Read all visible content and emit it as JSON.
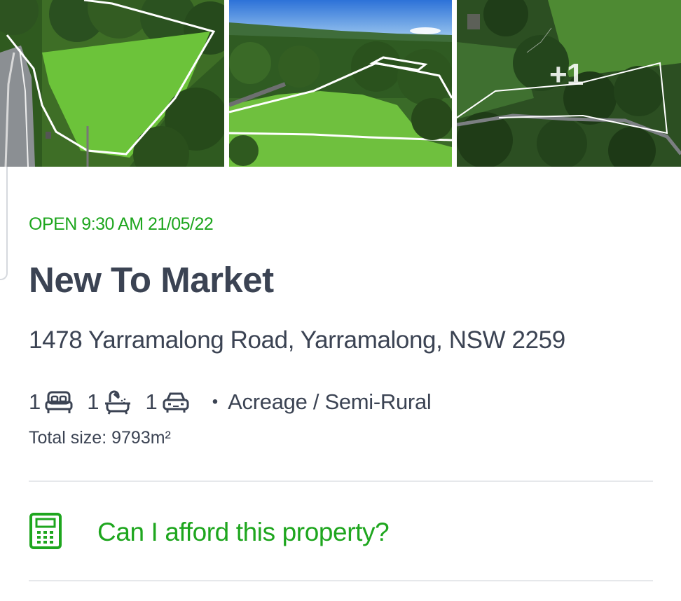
{
  "gallery": {
    "photos": [
      {
        "label": "Aerial photo of cleared grass block with boundary outline beside road"
      },
      {
        "label": "Aerial photo of grassy paddock surrounded by forest with boundary outline"
      },
      {
        "label": "Aerial overhead photo of the property with boundary outline"
      }
    ],
    "more_count": "+1"
  },
  "listing": {
    "inspection": "OPEN 9:30 AM 21/05/22",
    "headline": "New To Market",
    "address": "1478 Yarramalong Road, Yarramalong, NSW 2259",
    "features": {
      "beds": "1",
      "baths": "1",
      "parking": "1",
      "separator": "•",
      "property_type": "Acreage / Semi-Rural"
    },
    "land_size": "Total size: 9793m²"
  },
  "affordability": {
    "label": "Can I afford this property?"
  },
  "colors": {
    "accent_green": "#1ea61e",
    "text_dark": "#3b4353",
    "divider": "#e6e8eb"
  }
}
